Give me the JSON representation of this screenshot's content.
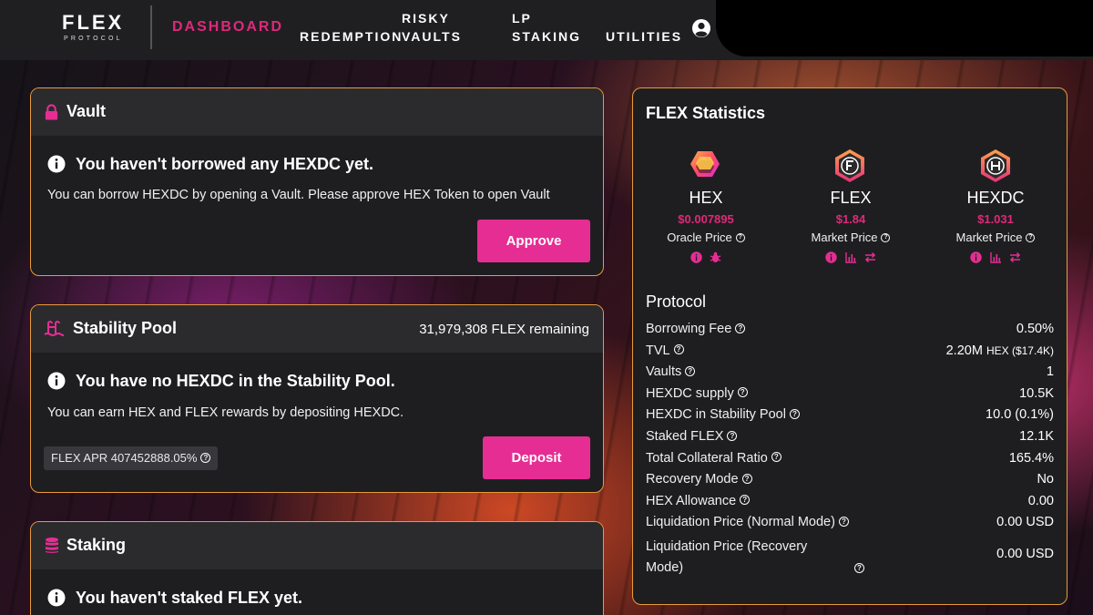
{
  "header": {
    "logo_main": "FLEX",
    "logo_sub": "PROTOCOL",
    "nav": {
      "dashboard": "DASHBOARD",
      "redemption": "REDEMPTION",
      "risky_line1": "RISKY",
      "risky_line2": "VAULTS",
      "lp_line1": "LP",
      "lp_line2": "STAKING",
      "utilities": "UTILITIES"
    },
    "user_icon": "user-circle-icon"
  },
  "vault": {
    "title": "Vault",
    "icon": "lock-icon",
    "message_title": "You haven't borrowed any HEXDC yet.",
    "message_body": "You can borrow HEXDC by opening a Vault. Please approve HEX Token to open Vault",
    "button": "Approve"
  },
  "stability_pool": {
    "title": "Stability Pool",
    "icon": "pool-icon",
    "remaining": "31,979,308 FLEX remaining",
    "message_title": "You have no HEXDC in the Stability Pool.",
    "message_body": "You can earn HEX and FLEX rewards by depositing HEXDC.",
    "apr": "FLEX APR 407452888.05%",
    "button": "Deposit"
  },
  "staking": {
    "title": "Staking",
    "icon": "database-icon",
    "message_title": "You haven't staked FLEX yet."
  },
  "stats": {
    "title": "FLEX Statistics",
    "tokens": [
      {
        "name": "HEX",
        "price": "$0.007895",
        "label": "Oracle Price",
        "icon": "hex-logo-icon"
      },
      {
        "name": "FLEX",
        "price": "$1.84",
        "label": "Market Price",
        "icon": "flex-logo-icon"
      },
      {
        "name": "HEXDC",
        "price": "$1.031",
        "label": "Market Price",
        "icon": "hexdc-logo-icon"
      }
    ],
    "protocol_title": "Protocol",
    "rows": [
      {
        "label": "Borrowing Fee",
        "value": "0.50%"
      },
      {
        "label": "TVL",
        "value": "2.20M",
        "value_small": "HEX ($17.4K)"
      },
      {
        "label": "Vaults",
        "value": "1"
      },
      {
        "label": "HEXDC supply",
        "value": "10.5K"
      },
      {
        "label": "HEXDC in Stability Pool",
        "value": "10.0 (0.1%)"
      },
      {
        "label": "Staked FLEX",
        "value": "12.1K"
      },
      {
        "label": "Total Collateral Ratio",
        "value": "165.4%"
      },
      {
        "label": "Recovery Mode",
        "value": "No"
      },
      {
        "label": "HEX Allowance",
        "value": "0.00"
      },
      {
        "label": "Liquidation Price (Normal Mode)",
        "value": "0.00 USD"
      }
    ],
    "last_row": {
      "label_line1": "Liquidation Price (Recovery",
      "label_line2": "Mode)",
      "value": "0.00 USD"
    }
  },
  "colors": {
    "accent_pink": "#e62d93",
    "border_orange": "#e89a3a",
    "card_bg": "#1e1e21",
    "header_bg": "#1f1f22"
  }
}
